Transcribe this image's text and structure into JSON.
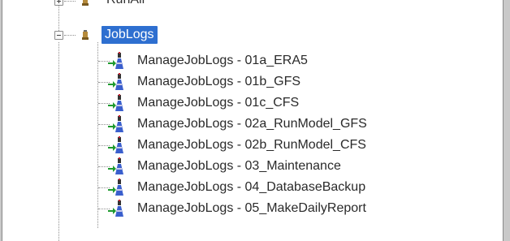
{
  "tree": {
    "parent_above": {
      "label": "RunAll",
      "expander": "plus"
    },
    "folder": {
      "label": "JobLogs",
      "expander": "minus",
      "selected": true
    },
    "items": [
      {
        "label": "ManageJobLogs - 01a_ERA5",
        "icon": "job-step-icon"
      },
      {
        "label": "ManageJobLogs - 01b_GFS",
        "icon": "job-step-icon"
      },
      {
        "label": "ManageJobLogs - 01c_CFS",
        "icon": "job-step-icon"
      },
      {
        "label": "ManageJobLogs - 02a_RunModel_GFS",
        "icon": "job-step-icon"
      },
      {
        "label": "ManageJobLogs - 02b_RunModel_CFS",
        "icon": "job-step-icon"
      },
      {
        "label": "ManageJobLogs - 03_Maintenance",
        "icon": "job-step-icon"
      },
      {
        "label": "ManageJobLogs - 04_DatabaseBackup",
        "icon": "job-step-icon"
      },
      {
        "label": "ManageJobLogs - 05_MakeDailyReport",
        "icon": "job-step-icon"
      }
    ]
  },
  "colors": {
    "selection": "#2e6fd0",
    "text": "#2a2a2a",
    "tree_lines": "#8f8f8f",
    "arrow": "#1e9a2e",
    "icon_blue": "#3a5fcd"
  }
}
